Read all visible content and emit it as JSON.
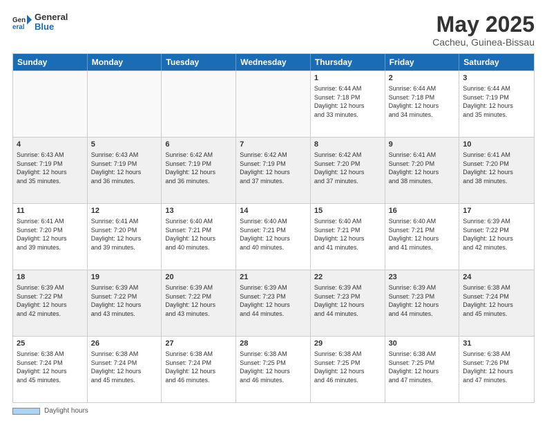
{
  "logo": {
    "general": "General",
    "blue": "Blue"
  },
  "header": {
    "title": "May 2025",
    "subtitle": "Cacheu, Guinea-Bissau"
  },
  "dayHeaders": [
    "Sunday",
    "Monday",
    "Tuesday",
    "Wednesday",
    "Thursday",
    "Friday",
    "Saturday"
  ],
  "weeks": [
    {
      "days": [
        {
          "num": "",
          "info": "",
          "empty": true
        },
        {
          "num": "",
          "info": "",
          "empty": true
        },
        {
          "num": "",
          "info": "",
          "empty": true
        },
        {
          "num": "",
          "info": "",
          "empty": true
        },
        {
          "num": "1",
          "info": "Sunrise: 6:44 AM\nSunset: 7:18 PM\nDaylight: 12 hours\nand 33 minutes.",
          "empty": false
        },
        {
          "num": "2",
          "info": "Sunrise: 6:44 AM\nSunset: 7:18 PM\nDaylight: 12 hours\nand 34 minutes.",
          "empty": false
        },
        {
          "num": "3",
          "info": "Sunrise: 6:44 AM\nSunset: 7:19 PM\nDaylight: 12 hours\nand 35 minutes.",
          "empty": false
        }
      ]
    },
    {
      "days": [
        {
          "num": "4",
          "info": "Sunrise: 6:43 AM\nSunset: 7:19 PM\nDaylight: 12 hours\nand 35 minutes.",
          "empty": false
        },
        {
          "num": "5",
          "info": "Sunrise: 6:43 AM\nSunset: 7:19 PM\nDaylight: 12 hours\nand 36 minutes.",
          "empty": false
        },
        {
          "num": "6",
          "info": "Sunrise: 6:42 AM\nSunset: 7:19 PM\nDaylight: 12 hours\nand 36 minutes.",
          "empty": false
        },
        {
          "num": "7",
          "info": "Sunrise: 6:42 AM\nSunset: 7:19 PM\nDaylight: 12 hours\nand 37 minutes.",
          "empty": false
        },
        {
          "num": "8",
          "info": "Sunrise: 6:42 AM\nSunset: 7:20 PM\nDaylight: 12 hours\nand 37 minutes.",
          "empty": false
        },
        {
          "num": "9",
          "info": "Sunrise: 6:41 AM\nSunset: 7:20 PM\nDaylight: 12 hours\nand 38 minutes.",
          "empty": false
        },
        {
          "num": "10",
          "info": "Sunrise: 6:41 AM\nSunset: 7:20 PM\nDaylight: 12 hours\nand 38 minutes.",
          "empty": false
        }
      ]
    },
    {
      "days": [
        {
          "num": "11",
          "info": "Sunrise: 6:41 AM\nSunset: 7:20 PM\nDaylight: 12 hours\nand 39 minutes.",
          "empty": false
        },
        {
          "num": "12",
          "info": "Sunrise: 6:41 AM\nSunset: 7:20 PM\nDaylight: 12 hours\nand 39 minutes.",
          "empty": false
        },
        {
          "num": "13",
          "info": "Sunrise: 6:40 AM\nSunset: 7:21 PM\nDaylight: 12 hours\nand 40 minutes.",
          "empty": false
        },
        {
          "num": "14",
          "info": "Sunrise: 6:40 AM\nSunset: 7:21 PM\nDaylight: 12 hours\nand 40 minutes.",
          "empty": false
        },
        {
          "num": "15",
          "info": "Sunrise: 6:40 AM\nSunset: 7:21 PM\nDaylight: 12 hours\nand 41 minutes.",
          "empty": false
        },
        {
          "num": "16",
          "info": "Sunrise: 6:40 AM\nSunset: 7:21 PM\nDaylight: 12 hours\nand 41 minutes.",
          "empty": false
        },
        {
          "num": "17",
          "info": "Sunrise: 6:39 AM\nSunset: 7:22 PM\nDaylight: 12 hours\nand 42 minutes.",
          "empty": false
        }
      ]
    },
    {
      "days": [
        {
          "num": "18",
          "info": "Sunrise: 6:39 AM\nSunset: 7:22 PM\nDaylight: 12 hours\nand 42 minutes.",
          "empty": false
        },
        {
          "num": "19",
          "info": "Sunrise: 6:39 AM\nSunset: 7:22 PM\nDaylight: 12 hours\nand 43 minutes.",
          "empty": false
        },
        {
          "num": "20",
          "info": "Sunrise: 6:39 AM\nSunset: 7:22 PM\nDaylight: 12 hours\nand 43 minutes.",
          "empty": false
        },
        {
          "num": "21",
          "info": "Sunrise: 6:39 AM\nSunset: 7:23 PM\nDaylight: 12 hours\nand 44 minutes.",
          "empty": false
        },
        {
          "num": "22",
          "info": "Sunrise: 6:39 AM\nSunset: 7:23 PM\nDaylight: 12 hours\nand 44 minutes.",
          "empty": false
        },
        {
          "num": "23",
          "info": "Sunrise: 6:39 AM\nSunset: 7:23 PM\nDaylight: 12 hours\nand 44 minutes.",
          "empty": false
        },
        {
          "num": "24",
          "info": "Sunrise: 6:38 AM\nSunset: 7:24 PM\nDaylight: 12 hours\nand 45 minutes.",
          "empty": false
        }
      ]
    },
    {
      "days": [
        {
          "num": "25",
          "info": "Sunrise: 6:38 AM\nSunset: 7:24 PM\nDaylight: 12 hours\nand 45 minutes.",
          "empty": false
        },
        {
          "num": "26",
          "info": "Sunrise: 6:38 AM\nSunset: 7:24 PM\nDaylight: 12 hours\nand 45 minutes.",
          "empty": false
        },
        {
          "num": "27",
          "info": "Sunrise: 6:38 AM\nSunset: 7:24 PM\nDaylight: 12 hours\nand 46 minutes.",
          "empty": false
        },
        {
          "num": "28",
          "info": "Sunrise: 6:38 AM\nSunset: 7:25 PM\nDaylight: 12 hours\nand 46 minutes.",
          "empty": false
        },
        {
          "num": "29",
          "info": "Sunrise: 6:38 AM\nSunset: 7:25 PM\nDaylight: 12 hours\nand 46 minutes.",
          "empty": false
        },
        {
          "num": "30",
          "info": "Sunrise: 6:38 AM\nSunset: 7:25 PM\nDaylight: 12 hours\nand 47 minutes.",
          "empty": false
        },
        {
          "num": "31",
          "info": "Sunrise: 6:38 AM\nSunset: 7:26 PM\nDaylight: 12 hours\nand 47 minutes.",
          "empty": false
        }
      ]
    }
  ],
  "footer": {
    "label": "Daylight hours"
  }
}
